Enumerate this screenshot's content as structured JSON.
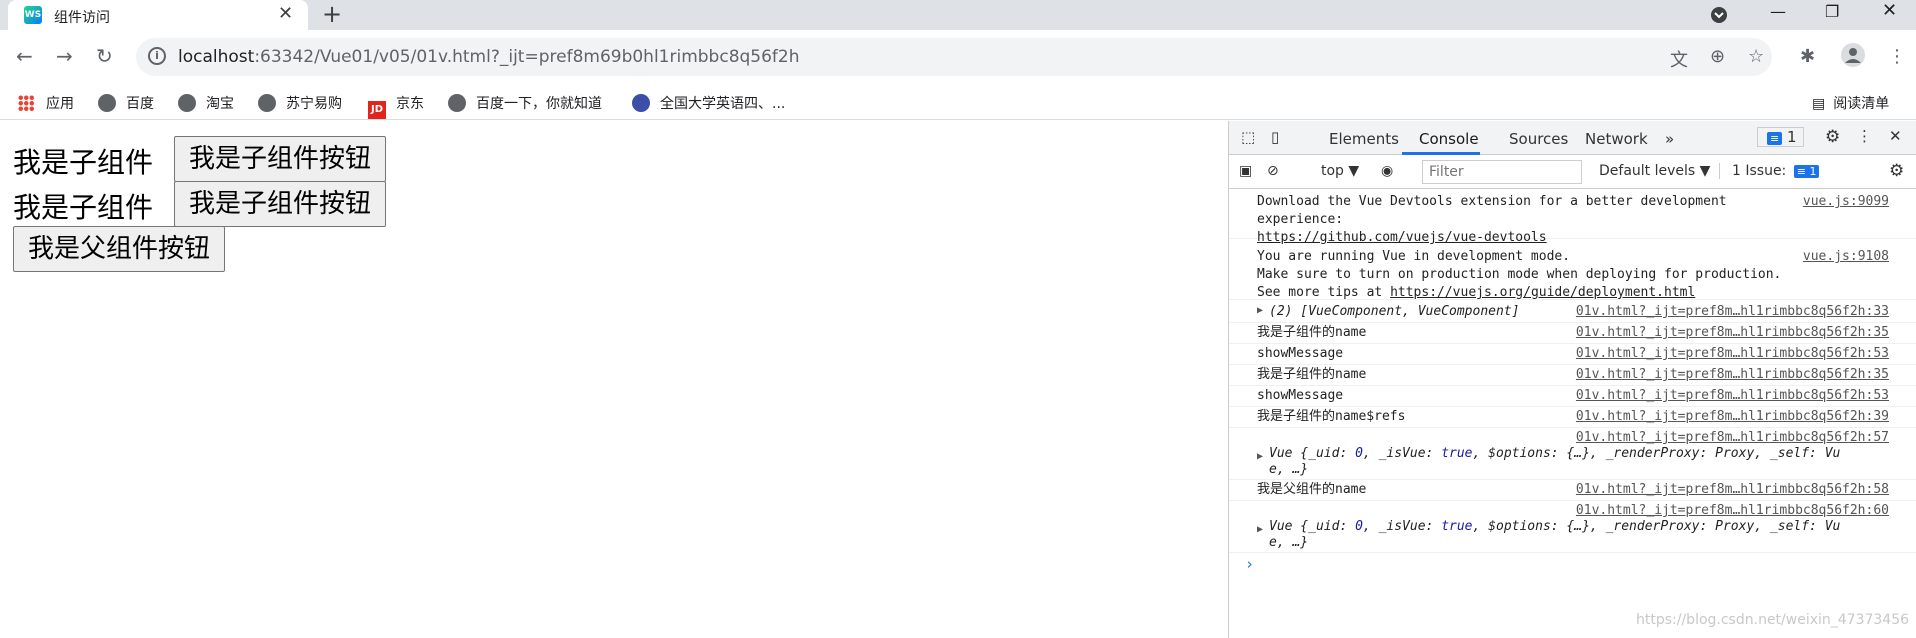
{
  "browser": {
    "tab_title": "组件访问",
    "tab_favicon": "WS",
    "new_tab": "+",
    "url_host": "localhost",
    "url_path": ":63342/Vue01/v05/01v.html?_ijt=pref8m69b0hl1rimbbc8q56f2h"
  },
  "bookmarks": {
    "items": [
      {
        "label": "应用",
        "icon": "apps-icon"
      },
      {
        "label": "百度",
        "icon": "globe-icon"
      },
      {
        "label": "淘宝",
        "icon": "globe-icon"
      },
      {
        "label": "苏宁易购",
        "icon": "globe-icon"
      },
      {
        "label": "京东",
        "icon": "jd-icon"
      },
      {
        "label": "百度一下，你就知道",
        "icon": "globe-icon"
      },
      {
        "label": "全国大学英语四、...",
        "icon": "cet-icon"
      }
    ],
    "reading_list": "阅读清单"
  },
  "page": {
    "child1_text": "我是子组件",
    "child1_button": "我是子组件按钮",
    "child2_text": "我是子组件",
    "child2_button": "我是子组件按钮",
    "parent_button": "我是父组件按钮"
  },
  "devtools": {
    "tabs": [
      "Elements",
      "Console",
      "Sources",
      "Network",
      "»"
    ],
    "active_tab": "Console",
    "issues_count": "1",
    "context": "top",
    "filter_placeholder": "Filter",
    "levels": "Default levels",
    "issue_label": "1 Issue:",
    "issue_count": "1",
    "messages": {
      "m1_line1": "Download the Vue Devtools extension for a better development",
      "m1_line2": "experience:",
      "m1_link": "https://github.com/vuejs/vue-devtools",
      "m1_src": "vue.js:9099",
      "m2_line1": "You are running Vue in development mode.",
      "m2_line2": "Make sure to turn on production mode when deploying for production.",
      "m2_line3_prefix": "See more tips at ",
      "m2_link": "https://vuejs.org/guide/deployment.html",
      "m2_src": "vue.js:9108",
      "m3": "(2) [VueComponent, VueComponent]",
      "m3_src": "01v.html?_ijt=pref8m…hl1rimbbc8q56f2h:33",
      "m4": "我是子组件的name",
      "m4_src": "01v.html?_ijt=pref8m…hl1rimbbc8q56f2h:35",
      "m5": "showMessage",
      "m5_src": "01v.html?_ijt=pref8m…hl1rimbbc8q56f2h:53",
      "m6": "我是子组件的name",
      "m6_src": "01v.html?_ijt=pref8m…hl1rimbbc8q56f2h:35",
      "m7": "showMessage",
      "m7_src": "01v.html?_ijt=pref8m…hl1rimbbc8q56f2h:53",
      "m8": "我是子组件的name$refs",
      "m8_src": "01v.html?_ijt=pref8m…hl1rimbbc8q56f2h:39",
      "m9_src": "01v.html?_ijt=pref8m…hl1rimbbc8q56f2h:57",
      "m9_a": "Vue {_uid: ",
      "m9_b": "0",
      "m9_c": ", _isVue: ",
      "m9_d": "true",
      "m9_e": ", $options: {…}, _renderProxy: Proxy, _self: Vu",
      "m9_f": "e, …}",
      "m10": "我是父组件的name",
      "m10_src": "01v.html?_ijt=pref8m…hl1rimbbc8q56f2h:58",
      "m11_src": "01v.html?_ijt=pref8m…hl1rimbbc8q56f2h:60",
      "m11_a": "Vue {_uid: ",
      "m11_b": "0",
      "m11_c": ", _isVue: ",
      "m11_d": "true",
      "m11_e": ", $options: {…}, _renderProxy: Proxy, _self: Vu",
      "m11_f": "e, …}",
      "prompt": "›"
    }
  },
  "watermark": "https://blog.csdn.net/weixin_47373456"
}
